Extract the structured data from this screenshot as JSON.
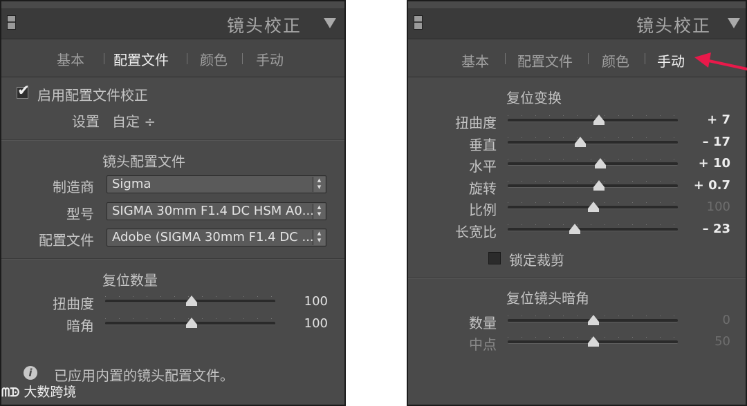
{
  "left": {
    "header_title": "镜头校正",
    "tabs": [
      "基本",
      "配置文件",
      "颜色",
      "手动"
    ],
    "active_tab": "配置文件",
    "enable_profile_label": "启用配置文件校正",
    "setup_label": "设置",
    "setup_value": "自定 ÷",
    "lens_profile_title": "镜头配置文件",
    "maker_label": "制造商",
    "maker_value": "Sigma",
    "model_label": "型号",
    "model_value": "SIGMA 30mm F1.4 DC HSM A0...",
    "profile_label": "配置文件",
    "profile_value": "Adobe (SIGMA 30mm F1.4 DC ...",
    "amount_title": "复位数量",
    "sliders": [
      {
        "label": "扭曲度",
        "value": "100",
        "fraction": 0.51
      },
      {
        "label": "暗角",
        "value": "100",
        "fraction": 0.51
      }
    ],
    "info_text": "已应用内置的镜头配置文件。"
  },
  "right": {
    "header_title": "镜头校正",
    "tabs": [
      "基本",
      "配置文件",
      "颜色",
      "手动"
    ],
    "active_tab": "手动",
    "transform_title": "复位变换",
    "sliders": [
      {
        "label": "扭曲度",
        "value": "+ 7",
        "fraction": 0.535
      },
      {
        "label": "垂直",
        "value": "– 17",
        "fraction": 0.425
      },
      {
        "label": "水平",
        "value": "+ 10",
        "fraction": 0.545
      },
      {
        "label": "旋转",
        "value": "+ 0.7",
        "fraction": 0.535
      },
      {
        "label": "比例",
        "value": "100",
        "fraction": 0.505
      },
      {
        "label": "长宽比",
        "value": "– 23",
        "fraction": 0.395
      }
    ],
    "lock_crop_label": "锁定裁剪",
    "vignette_title": "复位镜头暗角",
    "vignette_sliders": [
      {
        "label": "数量",
        "value": "0",
        "fraction": 0.505
      },
      {
        "label": "中点",
        "value": "50",
        "fraction": 0.505
      }
    ]
  },
  "watermark": {
    "logo": "ᗰᗬ",
    "text": "大数跨境"
  },
  "colors": {
    "panel_bg": "#4a4a4a",
    "header_bg": "#3a3a3a",
    "arrow": "#e8194a"
  }
}
